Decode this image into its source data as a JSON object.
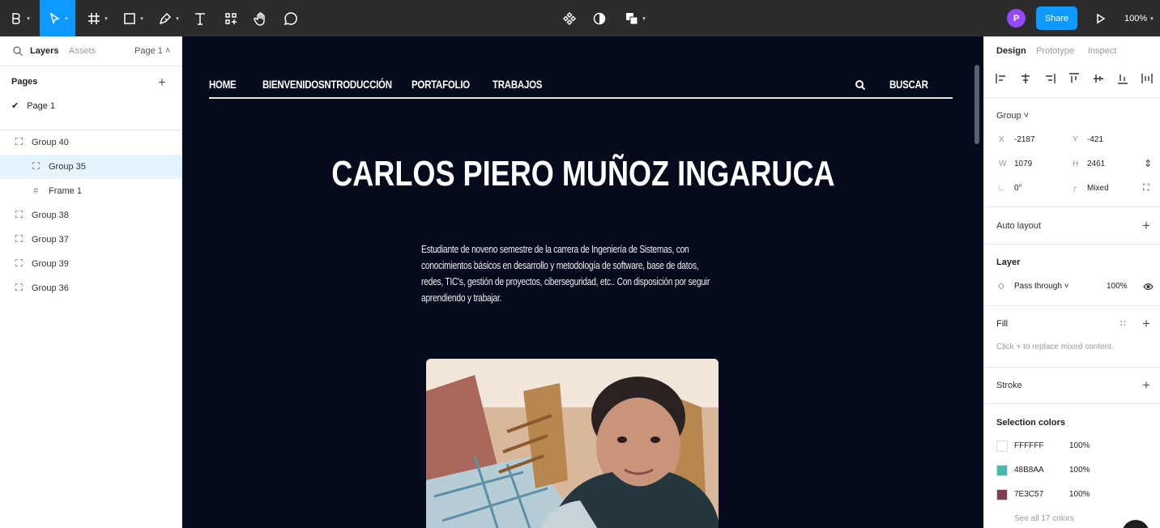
{
  "toolbar": {
    "tools": [
      "main-menu",
      "move",
      "frame",
      "shape",
      "pen",
      "text",
      "resources",
      "hand",
      "comment"
    ],
    "center_tools": [
      "component",
      "mask",
      "boolean"
    ],
    "avatar_initial": "P",
    "share_label": "Share",
    "zoom_label": "100%",
    "accent": "#0d99ff"
  },
  "left_panel": {
    "tabs": {
      "layers": "Layers",
      "assets": "Assets",
      "page": "Page 1 ˄"
    },
    "pages_title": "Pages",
    "current_page": "Page 1",
    "layers": [
      {
        "label": "Group 40",
        "icon": "group-icon",
        "indent": 0,
        "selected": false
      },
      {
        "label": "Group 35",
        "icon": "group-icon",
        "indent": 1,
        "selected": true
      },
      {
        "label": "Frame 1",
        "icon": "frame-icon",
        "indent": 1,
        "selected": false
      },
      {
        "label": "Group 38",
        "icon": "group-icon",
        "indent": 0,
        "selected": false
      },
      {
        "label": "Group 37",
        "icon": "group-icon",
        "indent": 0,
        "selected": false
      },
      {
        "label": "Group 39",
        "icon": "group-icon",
        "indent": 0,
        "selected": false
      },
      {
        "label": "Group 36",
        "icon": "group-icon",
        "indent": 0,
        "selected": false
      }
    ]
  },
  "canvas": {
    "background": "#050a1c",
    "nav": {
      "links": [
        "HOME",
        "BIENVENIDOSNTRODUCCIÓN",
        "PORTAFOLIO",
        "TRABAJOS"
      ],
      "search_label": "BUSCAR"
    },
    "title": "CARLOS PIERO MUÑOZ INGARUCA",
    "bio_lines": [
      "Estudiante de noveno semestre de la carrera de Ingeniería de Sistemas, con",
      "conocimientos básicos en desarrollo y metodología de software, base de datos,",
      "redes, TIC's, gestión de proyectos, ciberseguridad, etc.. Con disposición por seguir",
      "aprendiendo y trabajar."
    ]
  },
  "right_panel": {
    "tabs": {
      "design": "Design",
      "prototype": "Prototype",
      "inspect": "Inspect"
    },
    "group": {
      "title": "Group ˅",
      "x_label": "X",
      "x": "-2187",
      "y_label": "Y",
      "y": "-421",
      "w_label": "W",
      "w": "1079",
      "h_label": "H",
      "h": "2461",
      "rotation": "0°",
      "radius": "Mixed"
    },
    "auto_layout": "Auto layout",
    "layer": {
      "title": "Layer",
      "blend": "Pass through ˅",
      "opacity": "100%"
    },
    "fill": {
      "title": "Fill",
      "hint": "Click + to replace mixed content."
    },
    "stroke": "Stroke",
    "selection_colors": {
      "title": "Selection colors",
      "items": [
        {
          "hex": "FFFFFF",
          "opacity": "100%",
          "color": "#FFFFFF"
        },
        {
          "hex": "48B8AA",
          "opacity": "100%",
          "color": "#48B8AA"
        },
        {
          "hex": "7E3C57",
          "opacity": "100%",
          "color": "#7E3C57"
        }
      ],
      "see_all": "See all 17 colors"
    }
  }
}
